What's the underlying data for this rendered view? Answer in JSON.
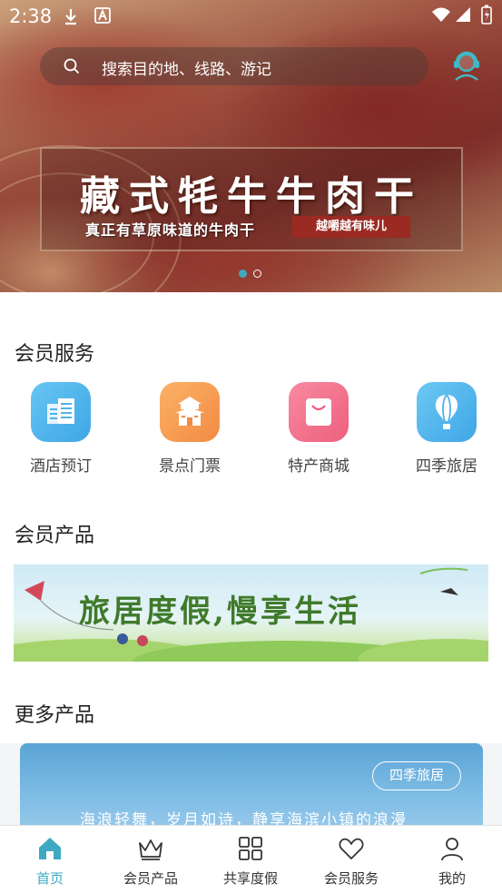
{
  "status_bar": {
    "time": "2:38"
  },
  "search": {
    "placeholder": "搜索目的地、线路、游记"
  },
  "banner": {
    "title": "藏式牦牛牛肉干",
    "subtitle": "真正有草原味道的牛肉干",
    "tag": "越嚼越有味儿",
    "slide_count": 2,
    "active_slide": 1
  },
  "member_services": {
    "title": "会员服务",
    "items": [
      {
        "label": "酒店预订",
        "icon": "hotel-icon",
        "color": "#4fb3ea"
      },
      {
        "label": "景点门票",
        "icon": "temple-icon",
        "color": "#f79a4f"
      },
      {
        "label": "特产商城",
        "icon": "shopping-bag-icon",
        "color": "#f0718c"
      },
      {
        "label": "四季旅居",
        "icon": "hot-air-balloon-icon",
        "color": "#4fb3ea"
      }
    ]
  },
  "member_products": {
    "title": "会员产品",
    "banner_text": "旅居度假,慢享生活"
  },
  "more_products": {
    "title": "更多产品",
    "card": {
      "badge": "四季旅居",
      "text": "海浪轻舞，岁月如诗，静享海滨小镇的浪漫"
    }
  },
  "bottom_nav": {
    "active_color": "#3ea9c2",
    "items": [
      {
        "label": "首页",
        "icon": "home-icon",
        "active": true
      },
      {
        "label": "会员产品",
        "icon": "crown-icon",
        "active": false
      },
      {
        "label": "共享度假",
        "icon": "grid-icon",
        "active": false
      },
      {
        "label": "会员服务",
        "icon": "heart-icon",
        "active": false
      },
      {
        "label": "我的",
        "icon": "user-icon",
        "active": false
      }
    ]
  }
}
